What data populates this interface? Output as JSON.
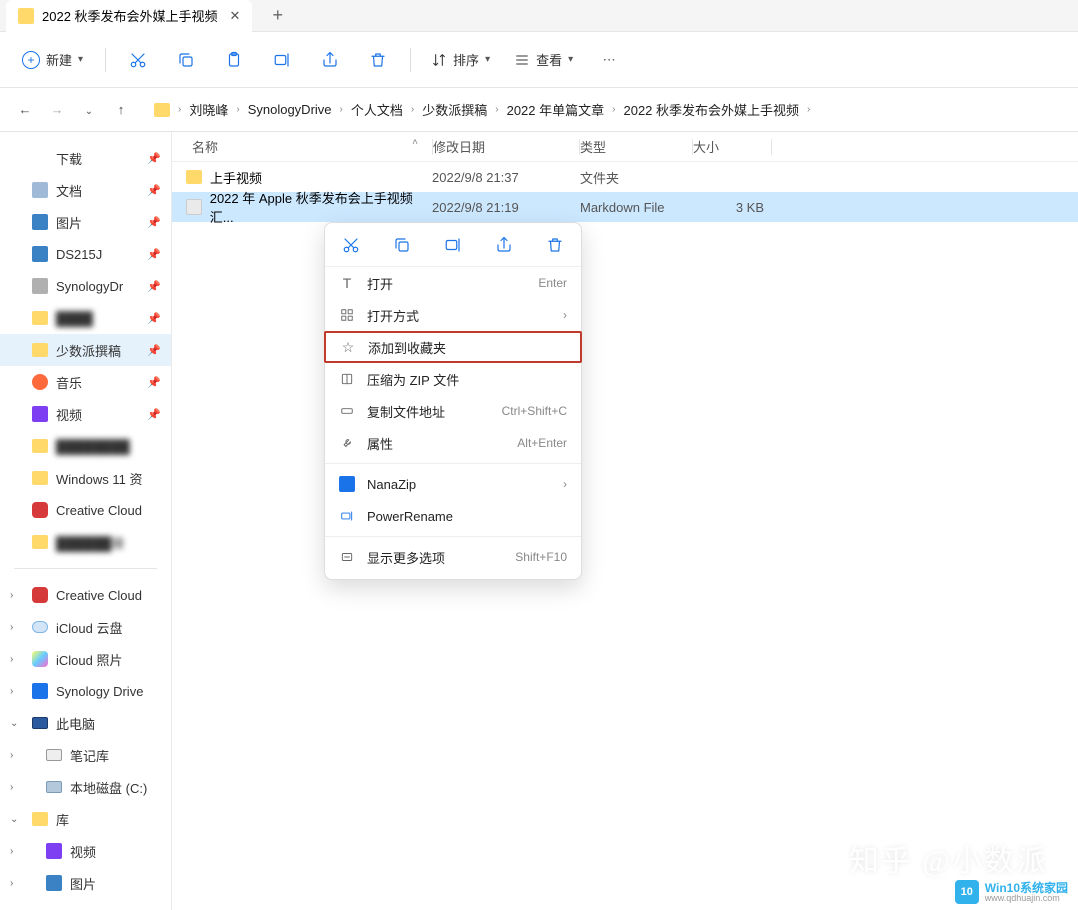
{
  "tab": {
    "title": "2022 秋季发布会外媒上手视频"
  },
  "toolbar": {
    "new_label": "新建",
    "sort_label": "排序",
    "view_label": "查看"
  },
  "breadcrumbs": [
    "刘晓峰",
    "SynologyDrive",
    "个人文档",
    "少数派撰稿",
    "2022 年单篇文章",
    "2022 秋季发布会外媒上手视频"
  ],
  "columns": {
    "name": "名称",
    "date": "修改日期",
    "type": "类型",
    "size": "大小"
  },
  "rows": [
    {
      "name": "上手视频",
      "date": "2022/9/8 21:37",
      "type": "文件夹",
      "size": "",
      "icon": "folder"
    },
    {
      "name": "2022 年 Apple 秋季发布会上手视频汇...",
      "date": "2022/9/8 21:19",
      "type": "Markdown File",
      "size": "3 KB",
      "icon": "md",
      "selected": true
    }
  ],
  "sidebar": {
    "quick": [
      {
        "label": "下载",
        "icon": "dl",
        "pinned": true
      },
      {
        "label": "文档",
        "icon": "doc",
        "pinned": true
      },
      {
        "label": "图片",
        "icon": "pic",
        "pinned": true
      },
      {
        "label": "DS215J",
        "icon": "drive",
        "pinned": true
      },
      {
        "label": "SynologyDr",
        "icon": "syn",
        "pinned": true
      },
      {
        "label": "████",
        "icon": "folder",
        "pinned": true,
        "blur": true
      },
      {
        "label": "少数派撰稿",
        "icon": "folder",
        "pinned": true,
        "selected": true
      },
      {
        "label": "音乐",
        "icon": "music",
        "pinned": true
      },
      {
        "label": "视频",
        "icon": "video",
        "pinned": true
      },
      {
        "label": "████████",
        "icon": "folder",
        "pinned": false,
        "blur": true
      },
      {
        "label": "Windows 11 资",
        "icon": "folder",
        "pinned": false
      },
      {
        "label": "Creative Cloud",
        "icon": "cc",
        "pinned": false
      },
      {
        "label": "██████接",
        "icon": "folder",
        "pinned": false,
        "blur": true
      }
    ],
    "locations": [
      {
        "label": "Creative Cloud",
        "icon": "cc",
        "expandable": true
      },
      {
        "label": "iCloud 云盘",
        "icon": "icloud",
        "expandable": true
      },
      {
        "label": "iCloud 照片",
        "icon": "icloudp",
        "expandable": true
      },
      {
        "label": "Synology Drive",
        "icon": "syno",
        "expandable": true
      },
      {
        "label": "此电脑",
        "icon": "pc",
        "expanded": true
      },
      {
        "label": "笔记库",
        "icon": "laptop",
        "expandable": true,
        "indent": true
      },
      {
        "label": "本地磁盘 (C:)",
        "icon": "hdd",
        "expandable": true,
        "indent": true
      },
      {
        "label": "库",
        "icon": "lib",
        "expanded": true
      },
      {
        "label": "视频",
        "icon": "video",
        "expandable": true,
        "indent": true
      },
      {
        "label": "图片",
        "icon": "pic",
        "expandable": true,
        "indent": true
      }
    ]
  },
  "ctx": {
    "open": "打开",
    "open_key": "Enter",
    "open_with": "打开方式",
    "add_fav": "添加到收藏夹",
    "zip": "压缩为 ZIP 文件",
    "copy_path": "复制文件地址",
    "copy_path_key": "Ctrl+Shift+C",
    "props": "属性",
    "props_key": "Alt+Enter",
    "nanazip": "NanaZip",
    "powerrename": "PowerRename",
    "more": "显示更多选项",
    "more_key": "Shift+F10"
  },
  "watermark": {
    "text": "知乎 @小数派",
    "brand1": "Win10系统家园",
    "brand2": "www.qdhuajin.com",
    "brand_logo": "10"
  }
}
